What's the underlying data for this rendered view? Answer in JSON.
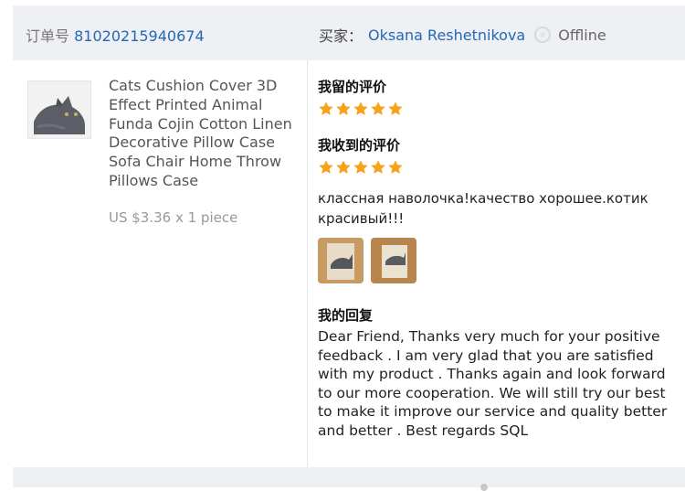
{
  "header": {
    "order_label": "订单号",
    "order_number": "81020215940674",
    "buyer_label": "买家：",
    "buyer_name": "Oksana Reshetnikova",
    "buyer_status": "Offline",
    "status_icon": "offline-status-icon"
  },
  "product": {
    "title": "Cats Cushion Cover 3D Effect Printed Animal Funda Cojin Cotton Linen Decorative Pillow Case Sofa Chair Home Throw Pillows Case",
    "price": "US $3.36 x 1 piece",
    "thumbnail_icon": "cat-pillow-image"
  },
  "my_review": {
    "title": "我留的评价",
    "rating": 5,
    "max_rating": 5
  },
  "received_review": {
    "title": "我收到的评价",
    "rating": 5,
    "max_rating": 5,
    "text": "классная наволочка!качество хорошее.котик красивый!!!",
    "photos": [
      "review-photo-1",
      "review-photo-2"
    ]
  },
  "my_reply": {
    "title": "我的回复",
    "text": "Dear Friend, Thanks very much for your positive feedback . I am very glad that you are satisfied with my product . Thanks again and look forward to our more cooperation. We will still try our best to make it improve our service and quality better and better . Best regards SQL"
  },
  "colors": {
    "link": "#2468b8",
    "star": "#f7a21b",
    "header_bg": "#eef0f3"
  }
}
